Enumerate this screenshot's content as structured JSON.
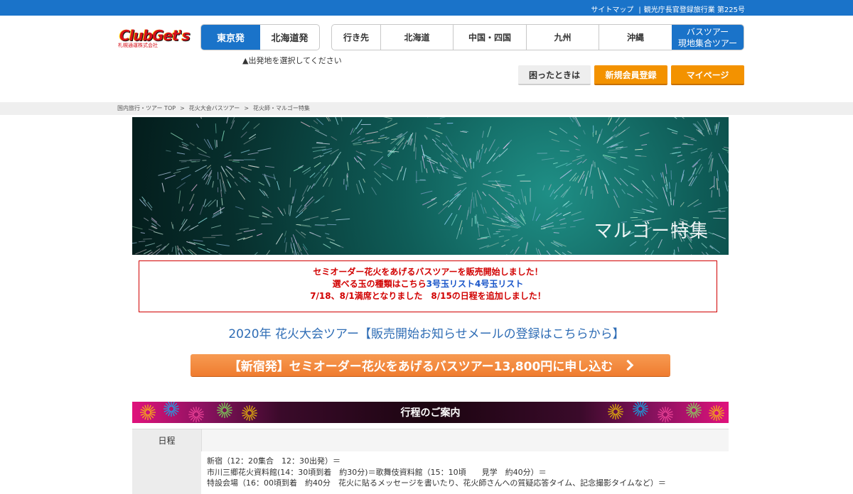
{
  "topbar": {
    "sitemap": "サイトマップ",
    "license": "観光庁長官登録旅行業 第225号"
  },
  "logo": {
    "main": "ClubGet's",
    "sub": "札幌通運株式会社"
  },
  "departure": {
    "options": [
      "東京発",
      "北海道発"
    ],
    "selected": "東京発",
    "note": "▲出発地を選択してください"
  },
  "destinations": {
    "label": "行き先",
    "items": [
      "北海道",
      "中国・四国",
      "九州",
      "沖縄"
    ],
    "bus_tour": [
      "バスツアー",
      "現地集合ツアー"
    ]
  },
  "utility": {
    "help": "困ったときは",
    "register": "新規会員登録",
    "mypage": "マイページ"
  },
  "breadcrumb": [
    "国内旅行・ツアー TOP",
    "花火大会バスツアー",
    "花火師・マルゴー特集"
  ],
  "hero": {
    "title": "マルゴー特集"
  },
  "notice": {
    "line1": "セミオーダー花火をあげるバスツアーを販売開始しました！",
    "line2_prefix": "選べる玉の種類はこちら",
    "line2_link1": "3号玉リスト",
    "line2_link2": "4号玉リスト",
    "line3": "7/18、8/1満席となりました　8/15の日程を追加しました！"
  },
  "section_link": "2020年 花火大会ツアー【販売開始お知らせメールの登録はこちらから】",
  "apply_button": "【新宿発】セミオーダー花火をあげるバスツアー13,800円に申し込む",
  "itinerary": {
    "title": "行程のご案内",
    "column_header": "日程",
    "lines": [
      "新宿（12：20集合　12：30出発）＝",
      "市川三郷花火資料館(14：30頃到着　約30分)＝歌舞伎資料館（15：10頃　　見学　約40分）＝",
      "特設会場（16：00頃到着　約40分　花火に貼るメッセージを書いたり、花火師さんへの質疑応答タイム、記念撮影タイムなど）＝"
    ]
  },
  "colors": {
    "primary_blue": "#1a73c9",
    "orange": "#f39200",
    "notice_red": "#d10000",
    "link_blue": "#2f6db5"
  }
}
